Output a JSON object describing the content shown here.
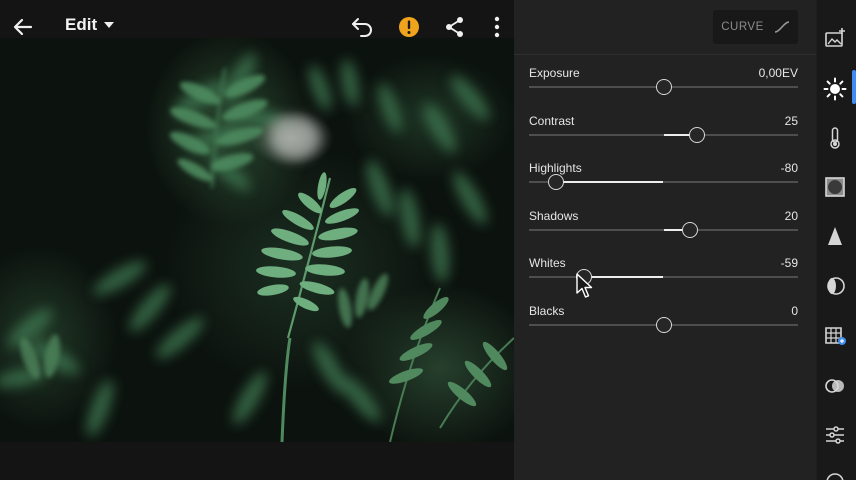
{
  "topbar": {
    "edit_label": "Edit",
    "icons": [
      "back-arrow-icon",
      "dropdown-caret-icon",
      "undo-icon",
      "warning-icon",
      "share-icon",
      "more-vertical-icon"
    ],
    "warning_color": "#f0a31c"
  },
  "photo": {
    "subject": "fern leaves"
  },
  "panel": {
    "curve_label": "CURVE",
    "sliders": [
      {
        "name": "Exposure",
        "value": "0,00EV",
        "position": 0.5,
        "center": 0.5
      },
      {
        "name": "Contrast",
        "value": "25",
        "position": 0.625,
        "center": 0.5
      },
      {
        "name": "Highlights",
        "value": "-80",
        "position": 0.1,
        "center": 0.5
      },
      {
        "name": "Shadows",
        "value": "20",
        "position": 0.6,
        "center": 0.5
      },
      {
        "name": "Whites",
        "value": "-59",
        "position": 0.205,
        "center": 0.5
      },
      {
        "name": "Blacks",
        "value": "0",
        "position": 0.5,
        "center": 0.5
      }
    ]
  },
  "rail": {
    "active_color": "#3f8df0",
    "items": [
      "auto-enhance-icon",
      "light-icon",
      "color-icon",
      "effects-icon",
      "detail-icon",
      "optics-icon",
      "geometry-icon",
      "presets-icon",
      "versions-icon"
    ],
    "active_index": 1
  }
}
